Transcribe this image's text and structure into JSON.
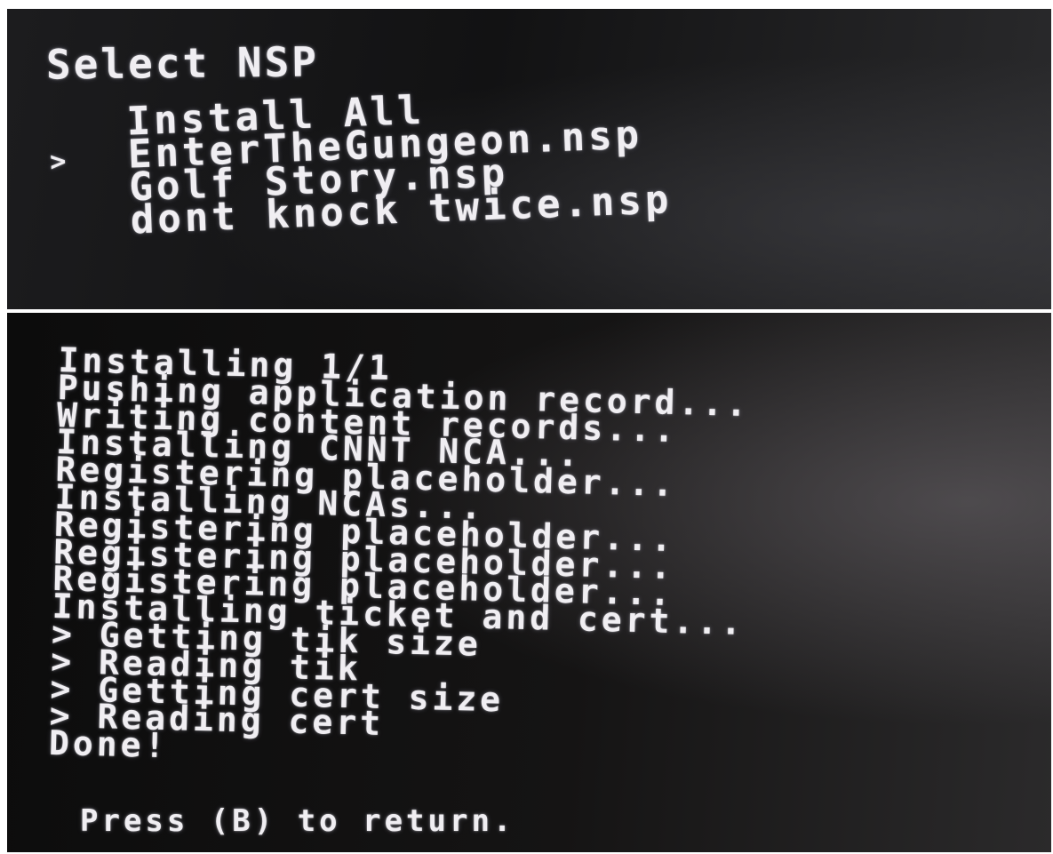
{
  "select_screen": {
    "title": "Select NSP",
    "cursor_glyph": ">",
    "items": [
      {
        "label": "Install All",
        "selected": false
      },
      {
        "label": "EnterTheGungeon.nsp",
        "selected": true
      },
      {
        "label": "Golf Story.nsp",
        "selected": false
      },
      {
        "label": "dont knock twice.nsp",
        "selected": false
      }
    ]
  },
  "install_screen": {
    "lines": [
      "Installing 1/1",
      "Pushing application record...",
      "Writing content records...",
      "Installing CNNT NCA...",
      "Registering placeholder...",
      "Installing NCAs...",
      "Registering placeholder...",
      "Registering placeholder...",
      "Registering placeholder...",
      "Installing ticket and cert...",
      "> Getting tik size",
      "> Reading tik",
      "> Getting cert size",
      "> Reading cert",
      "Done!"
    ],
    "prompt": "Press (B) to return."
  },
  "colors": {
    "text": "#f0eef2",
    "screen_background": "#121213"
  }
}
